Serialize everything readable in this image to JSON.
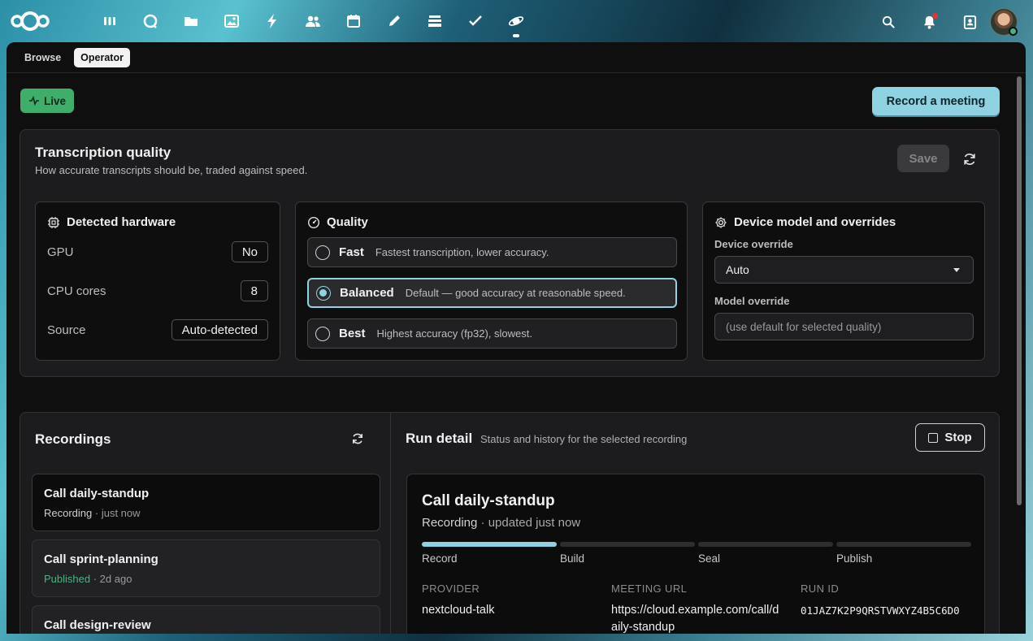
{
  "topbar": {
    "apps": [
      {
        "icon": "dashboard-icon"
      },
      {
        "icon": "talk-icon"
      },
      {
        "icon": "files-icon"
      },
      {
        "icon": "photos-icon"
      },
      {
        "icon": "activity-icon"
      },
      {
        "icon": "contacts-icon"
      },
      {
        "icon": "calendar-icon"
      },
      {
        "icon": "notes-icon"
      },
      {
        "icon": "deck-icon"
      },
      {
        "icon": "tasks-icon"
      },
      {
        "icon": "recorder-app-icon"
      }
    ],
    "right": [
      "search-icon",
      "notifications-icon",
      "contacts-menu-icon",
      "user-avatar"
    ]
  },
  "tabs": {
    "browse": "Browse",
    "operator": "Operator",
    "active": "Operator"
  },
  "live_badge": "Live",
  "record_button": "Record a meeting",
  "quality_section": {
    "title": "Transcription quality",
    "subtitle": "How accurate transcripts should be, traded against speed.",
    "save_label": "Save",
    "hardware": {
      "title": "Detected hardware",
      "rows": [
        {
          "label": "GPU",
          "value": "No"
        },
        {
          "label": "CPU cores",
          "value": "8"
        },
        {
          "label": "Source",
          "value": "Auto-detected"
        }
      ]
    },
    "quality": {
      "title": "Quality",
      "selected": "Balanced",
      "options": [
        {
          "name": "Fast",
          "desc": "Fastest transcription, lower accuracy."
        },
        {
          "name": "Balanced",
          "desc": "Default — good accuracy at reasonable speed."
        },
        {
          "name": "Best",
          "desc": "Highest accuracy (fp32), slowest."
        }
      ]
    },
    "device": {
      "title": "Device model and overrides",
      "device_override_label": "Device override",
      "device_override_value": "Auto",
      "model_override_label": "Model override",
      "model_override_placeholder": "(use default for selected quality)"
    }
  },
  "recordings": {
    "title": "Recordings",
    "items": [
      {
        "name": "Call daily-standup",
        "status": "Recording",
        "time": "just now"
      },
      {
        "name": "Call sprint-planning",
        "status": "Published",
        "time": "2d ago"
      },
      {
        "name": "Call design-review",
        "status": "",
        "time": ""
      }
    ]
  },
  "run_detail": {
    "title": "Run detail",
    "subtitle": "Status and history for the selected recording",
    "stop_label": "Stop",
    "name": "Call daily-standup",
    "status": "Recording",
    "updated": "updated just now",
    "steps": [
      {
        "label": "Record",
        "done": true
      },
      {
        "label": "Build",
        "done": false
      },
      {
        "label": "Seal",
        "done": false
      },
      {
        "label": "Publish",
        "done": false
      }
    ],
    "provider_label": "PROVIDER",
    "provider": "nextcloud-talk",
    "meeting_url_label": "MEETING URL",
    "meeting_url": "https://cloud.example.com/call/daily-standup",
    "run_id_label": "RUN ID",
    "run_id": "01JAZ7K2P9QRSTVWXYZ4B5C6D0"
  },
  "colors": {
    "accent": "#8fd3e3",
    "live": "#3fae6b",
    "published": "#49b382"
  }
}
